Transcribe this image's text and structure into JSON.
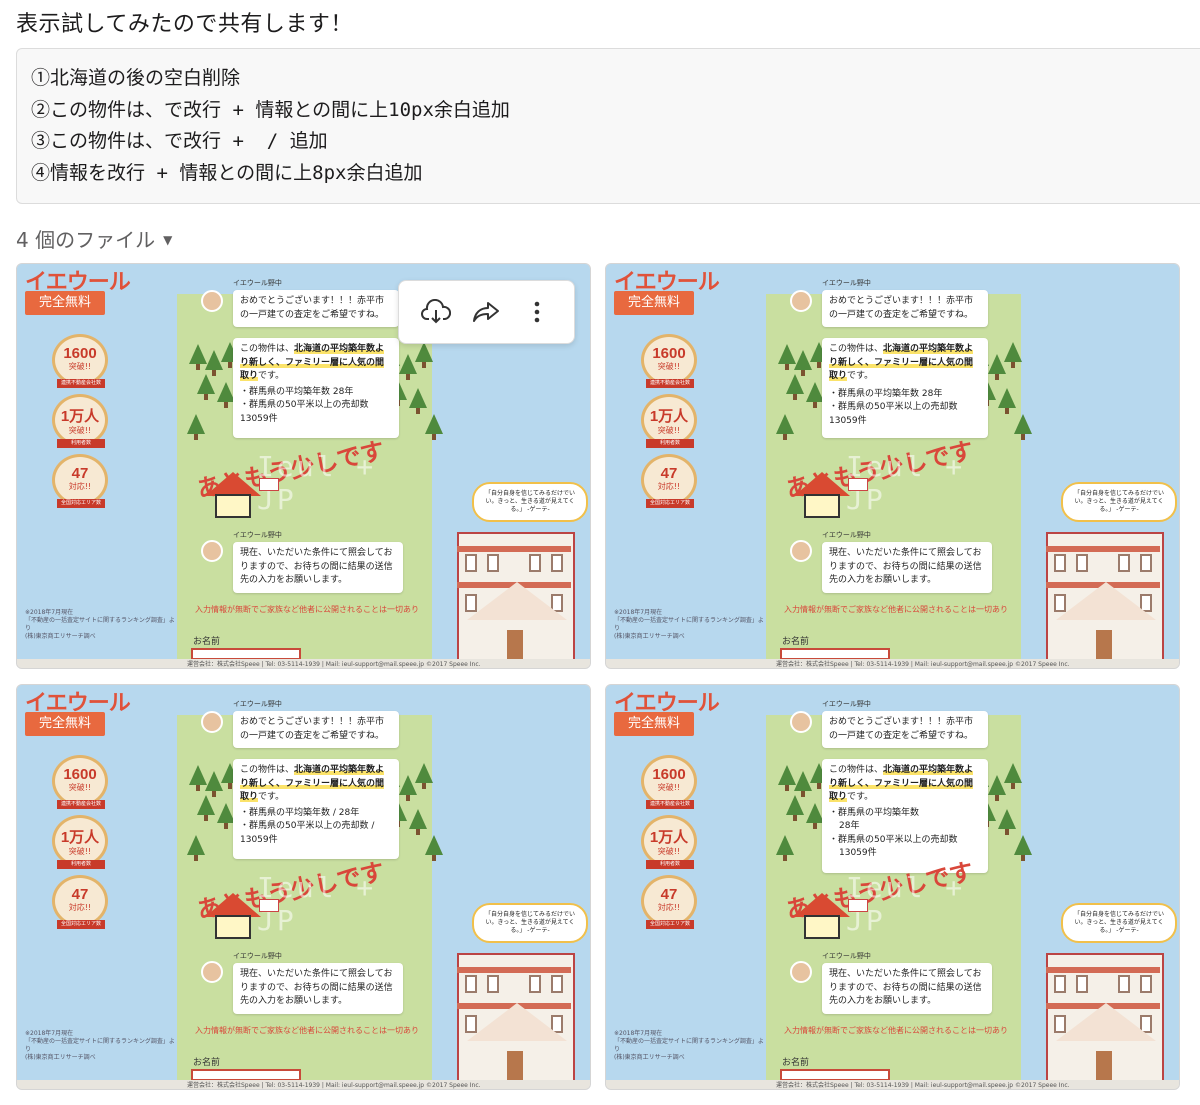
{
  "message": {
    "title": "表示試してみたので共有します！",
    "lines": [
      "①北海道の後の空白削除",
      "②この物件は、で改行 + 情報との間に上10px余白追加",
      "③この物件は、で改行 +  / 追加",
      "④情報を改行 + 情報との間に上8px余白追加"
    ]
  },
  "files": {
    "label": "4 個のファイル",
    "icons": {
      "toggle": "caret-down-icon",
      "download": "cloud-download-icon",
      "share": "share-arrow-icon",
      "more": "more-vertical-icon"
    }
  },
  "screenshots": [
    {
      "logo": "イエウール",
      "free": "完全無料",
      "medals": [
        {
          "num": "1600",
          "sub": "突破!!",
          "ribbon": "連携不動産会社数"
        },
        {
          "num": "1万人",
          "sub": "突破!!",
          "ribbon": "利用者数"
        },
        {
          "num": "47",
          "sub": "対応!!",
          "ribbon": "全国対応エリア数"
        }
      ],
      "footnote": "※2018年7月現在\n「不動産の一括査定サイトに関するランキング調査」より\n(株)東京商工リサーチ調べ",
      "agent": "イエウール野中",
      "greeting": "おめでとうございます！！！赤平市の一戸建ての査定をご希望ですね。",
      "prop_intro": "この物件は、",
      "prop_bold": "北海道の平均築年数より新しく、ファミリー層に人気の間取り",
      "prop_end": "です。",
      "info1": "・群馬県の平均築年数 28年",
      "info2": "・群馬県の50平米以上の売却数",
      "info3": "13059件",
      "motto": "あともう少しです",
      "watermark": "Ieul + JP",
      "reply": "現在、いただいた条件にて照会しておりますので、お待ちの間に結果の送信先の入力をお願いします。",
      "privacy": "入力情報が無断でご家族など他者に公開されることは一切あり",
      "name_label": "お名前",
      "quote": "「自分自身を信じてみるだけでいい。きっと、生きる道が見えてくる。」\n-ゲーテ-",
      "footer": "運営会社：株式会社Speee | Tel: 03-5114-1939 | Mail: ieul-support@mail.speee.jp   ©2017 Speee Inc."
    }
  ],
  "variants": [
    {
      "info1": "・群馬県の平均築年数 28年",
      "info2": "・群馬県の50平米以上の売却数",
      "info3": "13059件"
    },
    {
      "info1": "・群馬県の平均築年数 28年",
      "info2": "・群馬県の50平米以上の売却数",
      "info3": "13059件"
    },
    {
      "info1": "・群馬県の平均築年数 / 28年",
      "info2": "・群馬県の50平米以上の売却数 /",
      "info3": "13059件"
    },
    {
      "info1": "・群馬県の平均築年数",
      "info2": "28年",
      "info3": "・群馬県の50平米以上の売却数",
      "info4": "13059件"
    }
  ]
}
